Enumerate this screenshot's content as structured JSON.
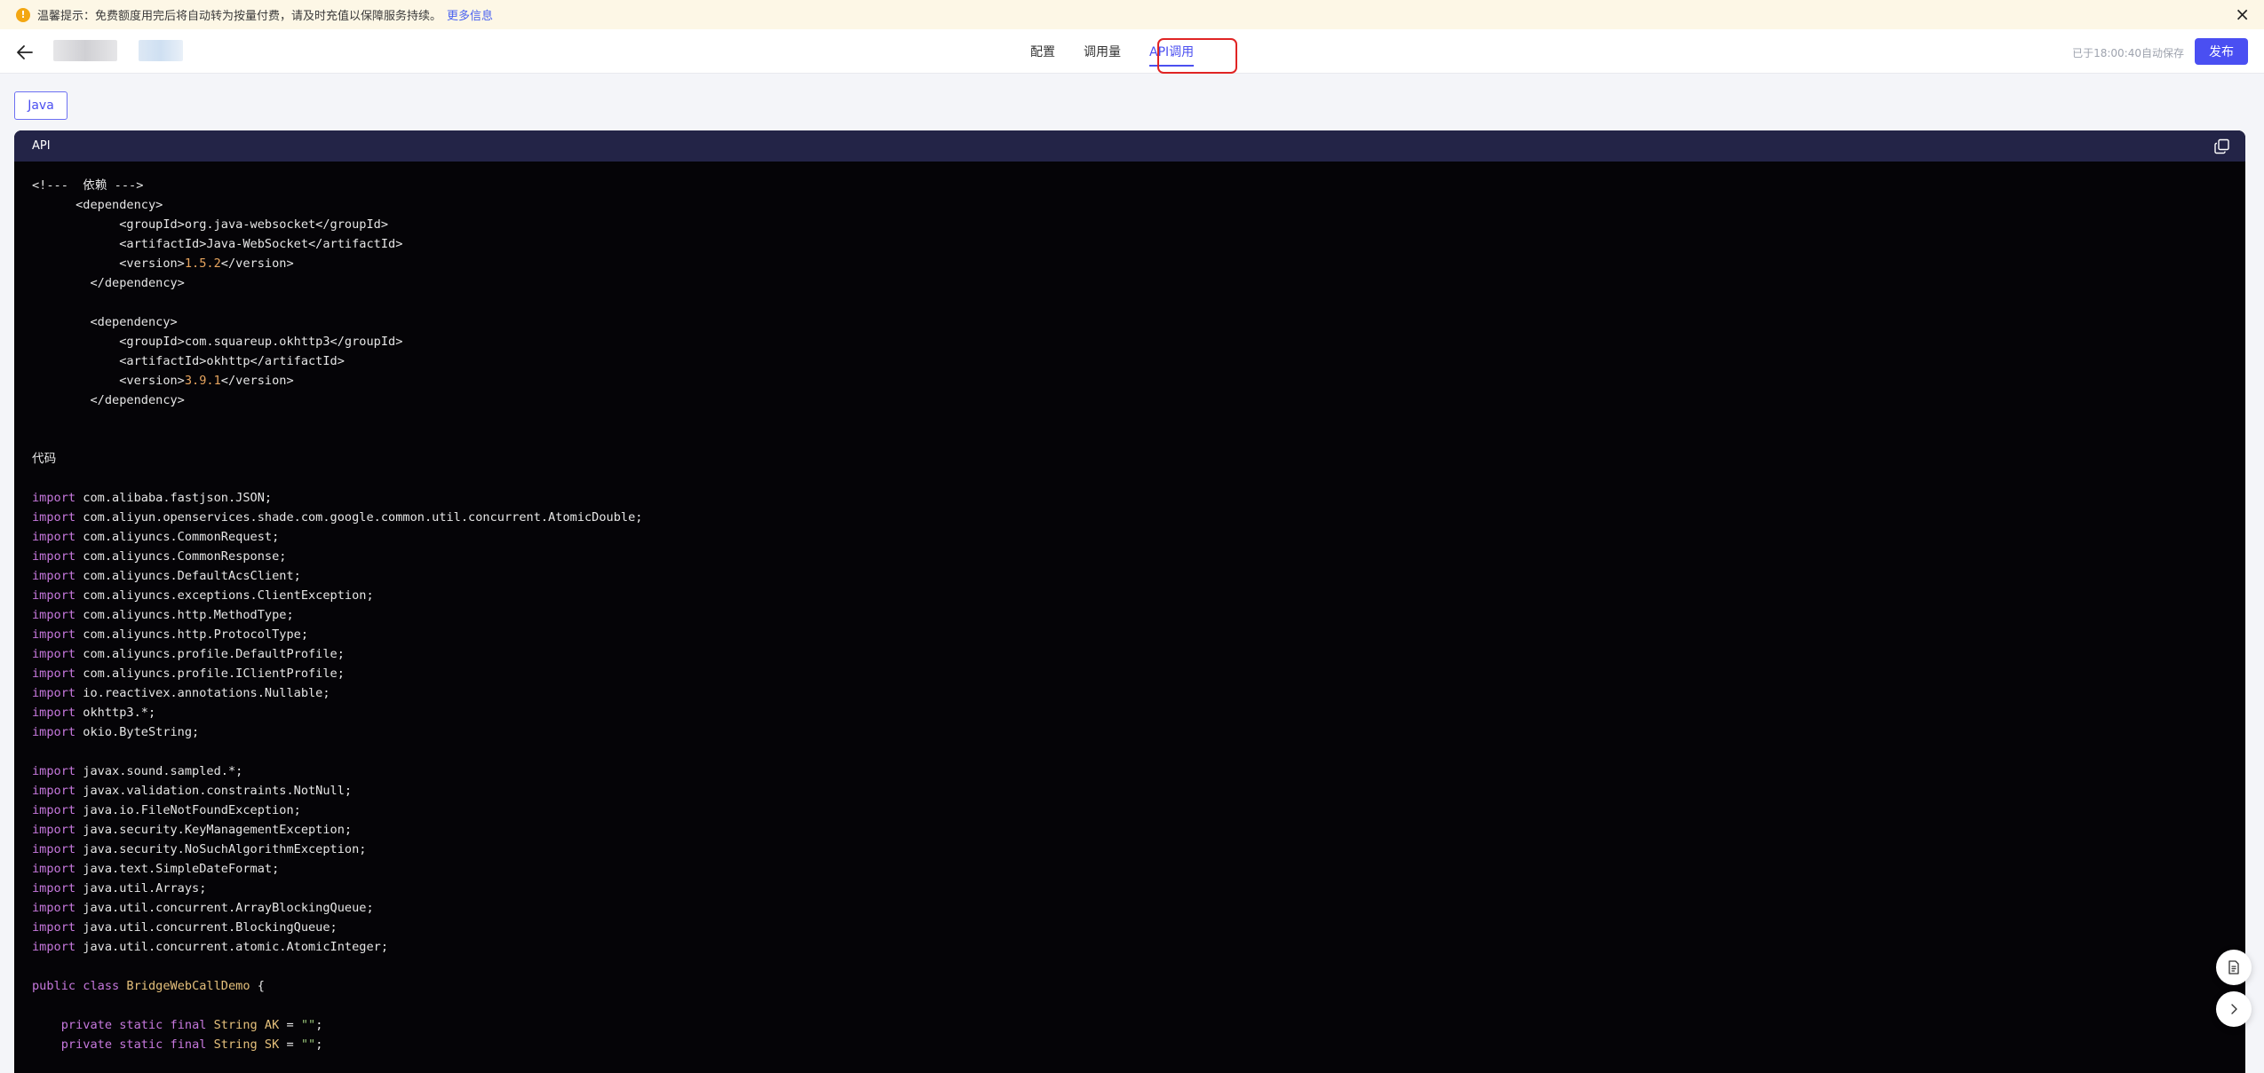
{
  "notice": {
    "text": "温馨提示：免费额度用完后将自动转为按量付费，请及时充值以保障服务持续。",
    "link": "更多信息"
  },
  "header": {
    "tabs": [
      "配置",
      "调用量",
      "API调用"
    ],
    "active_tab": 2,
    "autosave": "已于18:00:40自动保存",
    "publish": "发布"
  },
  "language": "Java",
  "panel": {
    "title": "API"
  },
  "code_section_label": "代码",
  "code_lines": [
    [
      [
        "t",
        "<!---  依赖 --->"
      ]
    ],
    [
      [
        "t",
        "      <dependency>"
      ]
    ],
    [
      [
        "t",
        "            <groupId>org.java-websocket</groupId>"
      ]
    ],
    [
      [
        "t",
        "            <artifactId>Java-WebSocket</artifactId>"
      ]
    ],
    [
      [
        "t",
        "            <version>"
      ],
      [
        "n",
        "1.5.2"
      ],
      [
        "t",
        "</version>"
      ]
    ],
    [
      [
        "t",
        "        </dependency>"
      ]
    ],
    [
      [
        "t",
        ""
      ]
    ],
    [
      [
        "t",
        "        <dependency>"
      ]
    ],
    [
      [
        "t",
        "            <groupId>com.squareup.okhttp3</groupId>"
      ]
    ],
    [
      [
        "t",
        "            <artifactId>okhttp</artifactId>"
      ]
    ],
    [
      [
        "t",
        "            <version>"
      ],
      [
        "n",
        "3.9.1"
      ],
      [
        "t",
        "</version>"
      ]
    ],
    [
      [
        "t",
        "        </dependency>"
      ]
    ],
    [
      [
        "t",
        ""
      ]
    ],
    [
      [
        "t",
        ""
      ]
    ],
    [
      [
        "t",
        "代码"
      ]
    ],
    [
      [
        "t",
        ""
      ]
    ],
    [
      [
        "k",
        "import"
      ],
      [
        "t",
        " com.alibaba.fastjson.JSON;"
      ]
    ],
    [
      [
        "k",
        "import"
      ],
      [
        "t",
        " com.aliyun.openservices.shade.com.google.common.util.concurrent.AtomicDouble;"
      ]
    ],
    [
      [
        "k",
        "import"
      ],
      [
        "t",
        " com.aliyuncs.CommonRequest;"
      ]
    ],
    [
      [
        "k",
        "import"
      ],
      [
        "t",
        " com.aliyuncs.CommonResponse;"
      ]
    ],
    [
      [
        "k",
        "import"
      ],
      [
        "t",
        " com.aliyuncs.DefaultAcsClient;"
      ]
    ],
    [
      [
        "k",
        "import"
      ],
      [
        "t",
        " com.aliyuncs.exceptions.ClientException;"
      ]
    ],
    [
      [
        "k",
        "import"
      ],
      [
        "t",
        " com.aliyuncs.http.MethodType;"
      ]
    ],
    [
      [
        "k",
        "import"
      ],
      [
        "t",
        " com.aliyuncs.http.ProtocolType;"
      ]
    ],
    [
      [
        "k",
        "import"
      ],
      [
        "t",
        " com.aliyuncs.profile.DefaultProfile;"
      ]
    ],
    [
      [
        "k",
        "import"
      ],
      [
        "t",
        " com.aliyuncs.profile.IClientProfile;"
      ]
    ],
    [
      [
        "k",
        "import"
      ],
      [
        "t",
        " io.reactivex.annotations.Nullable;"
      ]
    ],
    [
      [
        "k",
        "import"
      ],
      [
        "t",
        " okhttp3.*;"
      ]
    ],
    [
      [
        "k",
        "import"
      ],
      [
        "t",
        " okio.ByteString;"
      ]
    ],
    [
      [
        "t",
        ""
      ]
    ],
    [
      [
        "k",
        "import"
      ],
      [
        "t",
        " javax.sound.sampled.*;"
      ]
    ],
    [
      [
        "k",
        "import"
      ],
      [
        "t",
        " javax.validation.constraints.NotNull;"
      ]
    ],
    [
      [
        "k",
        "import"
      ],
      [
        "t",
        " java.io.FileNotFoundException;"
      ]
    ],
    [
      [
        "k",
        "import"
      ],
      [
        "t",
        " java.security.KeyManagementException;"
      ]
    ],
    [
      [
        "k",
        "import"
      ],
      [
        "t",
        " java.security.NoSuchAlgorithmException;"
      ]
    ],
    [
      [
        "k",
        "import"
      ],
      [
        "t",
        " java.text.SimpleDateFormat;"
      ]
    ],
    [
      [
        "k",
        "import"
      ],
      [
        "t",
        " java.util.Arrays;"
      ]
    ],
    [
      [
        "k",
        "import"
      ],
      [
        "t",
        " java.util.concurrent.ArrayBlockingQueue;"
      ]
    ],
    [
      [
        "k",
        "import"
      ],
      [
        "t",
        " java.util.concurrent.BlockingQueue;"
      ]
    ],
    [
      [
        "k",
        "import"
      ],
      [
        "t",
        " java.util.concurrent.atomic.AtomicInteger;"
      ]
    ],
    [
      [
        "t",
        ""
      ]
    ],
    [
      [
        "k",
        "public class"
      ],
      [
        "t",
        " "
      ],
      [
        "c",
        "BridgeWebCallDemo"
      ],
      [
        "t",
        " {"
      ]
    ],
    [
      [
        "t",
        ""
      ]
    ],
    [
      [
        "t",
        "    "
      ],
      [
        "k",
        "private static final"
      ],
      [
        "t",
        " "
      ],
      [
        "c",
        "String"
      ],
      [
        "t",
        " "
      ],
      [
        "c",
        "AK"
      ],
      [
        "t",
        " = "
      ],
      [
        "s",
        "\"\""
      ],
      [
        "t",
        ";"
      ]
    ],
    [
      [
        "t",
        "    "
      ],
      [
        "k",
        "private static final"
      ],
      [
        "t",
        " "
      ],
      [
        "c",
        "String"
      ],
      [
        "t",
        " "
      ],
      [
        "c",
        "SK"
      ],
      [
        "t",
        " = "
      ],
      [
        "s",
        "\"\""
      ],
      [
        "t",
        ";"
      ]
    ]
  ],
  "icons": {
    "warning": "warning-icon",
    "close": "close-icon",
    "back": "arrow-left-icon",
    "copy": "copy-icon",
    "doc": "document-icon",
    "next": "chevron-right-icon"
  },
  "colors": {
    "accent": "#4a4ff2",
    "highlight_border": "#e02424",
    "panel_header": "#232447",
    "code_bg": "#050407",
    "keyword": "#c678dd",
    "class_name": "#e5c07b",
    "number": "#e8a55f"
  }
}
